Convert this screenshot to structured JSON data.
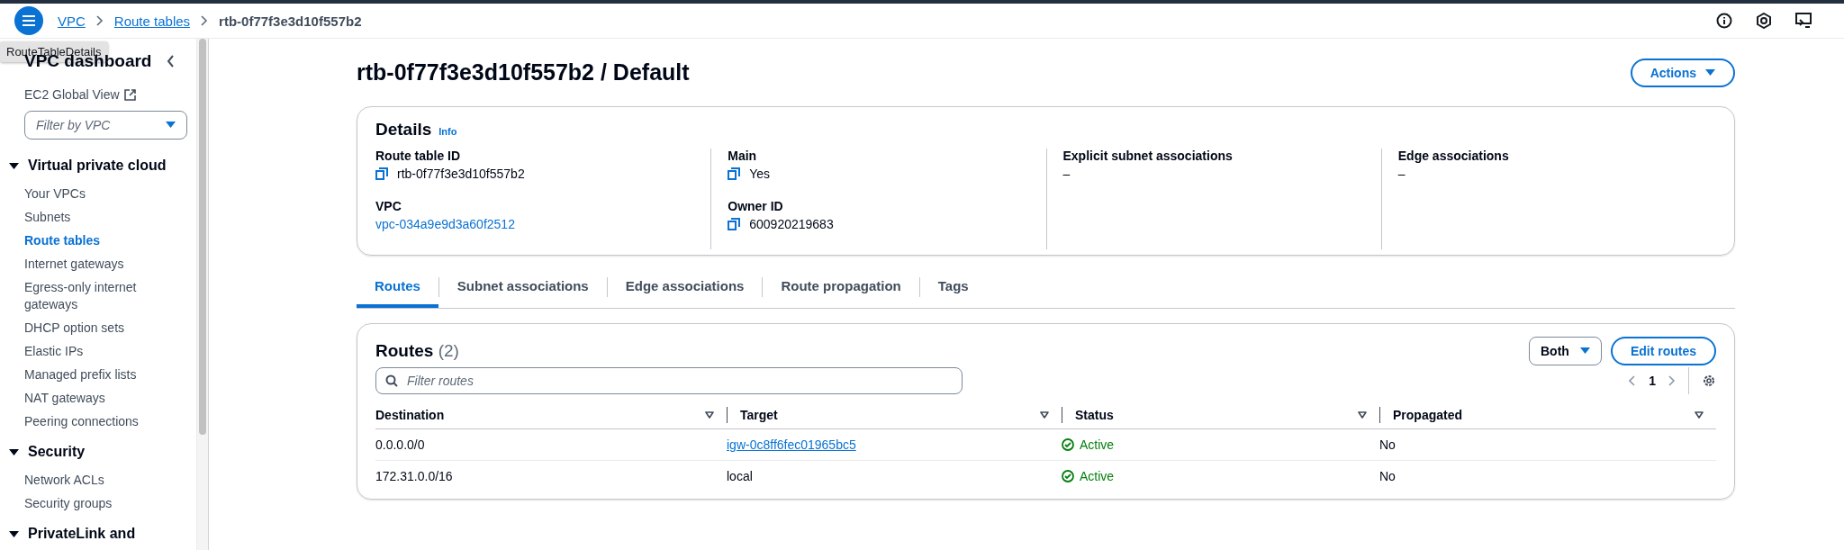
{
  "breadcrumbs": [
    {
      "label": "VPC",
      "current": false
    },
    {
      "label": "Route tables",
      "current": false
    },
    {
      "label": "rtb-0f77f3e3d10f557b2",
      "current": true
    }
  ],
  "tooltip": "RouteTableDetails",
  "sidebar": {
    "title": "VPC dashboard",
    "global_view": "EC2 Global View",
    "filter": {
      "placeholder": "Filter by VPC"
    },
    "sections": [
      {
        "title": "Virtual private cloud",
        "expanded": true,
        "items": [
          {
            "label": "Your VPCs",
            "selected": false
          },
          {
            "label": "Subnets",
            "selected": false
          },
          {
            "label": "Route tables",
            "selected": true
          },
          {
            "label": "Internet gateways",
            "selected": false
          },
          {
            "label": "Egress-only internet gateways",
            "selected": false
          },
          {
            "label": "DHCP option sets",
            "selected": false
          },
          {
            "label": "Elastic IPs",
            "selected": false
          },
          {
            "label": "Managed prefix lists",
            "selected": false
          },
          {
            "label": "NAT gateways",
            "selected": false
          },
          {
            "label": "Peering connections",
            "selected": false
          }
        ]
      },
      {
        "title": "Security",
        "expanded": true,
        "items": [
          {
            "label": "Network ACLs",
            "selected": false
          },
          {
            "label": "Security groups",
            "selected": false
          }
        ]
      },
      {
        "title": "PrivateLink and",
        "expanded": true
      }
    ]
  },
  "page_title": "rtb-0f77f3e3d10f557b2 / Default",
  "actions_button": "Actions",
  "details": {
    "title": "Details",
    "info": "Info",
    "columns": [
      [
        {
          "label": "Route table ID",
          "value": "rtb-0f77f3e3d10f557b2",
          "kind": "copy"
        },
        {
          "label": "VPC",
          "value": "vpc-034a9e9d3a60f2512",
          "kind": "link"
        }
      ],
      [
        {
          "label": "Main",
          "value": "Yes",
          "kind": "copy"
        },
        {
          "label": "Owner ID",
          "value": "600920219683",
          "kind": "copy"
        }
      ],
      [
        {
          "label": "Explicit subnet associations",
          "value": "–",
          "kind": "text"
        }
      ],
      [
        {
          "label": "Edge associations",
          "value": "–",
          "kind": "text"
        }
      ]
    ]
  },
  "tabs": [
    {
      "label": "Routes",
      "selected": true
    },
    {
      "label": "Subnet associations",
      "selected": false
    },
    {
      "label": "Edge associations",
      "selected": false
    },
    {
      "label": "Route propagation",
      "selected": false
    },
    {
      "label": "Tags",
      "selected": false
    }
  ],
  "routes": {
    "title": "Routes",
    "count": "(2)",
    "filter_select": "Both",
    "edit_button": "Edit routes",
    "search": {
      "placeholder": "Filter routes"
    },
    "page": "1",
    "columns": [
      "Destination",
      "Target",
      "Status",
      "Propagated"
    ],
    "rows": [
      {
        "destination": "0.0.0.0/0",
        "target": "igw-0c8ff6fec01965bc5",
        "target_link": true,
        "status": "Active",
        "propagated": "No"
      },
      {
        "destination": "172.31.0.0/16",
        "target": "local",
        "target_link": false,
        "status": "Active",
        "propagated": "No"
      }
    ]
  }
}
